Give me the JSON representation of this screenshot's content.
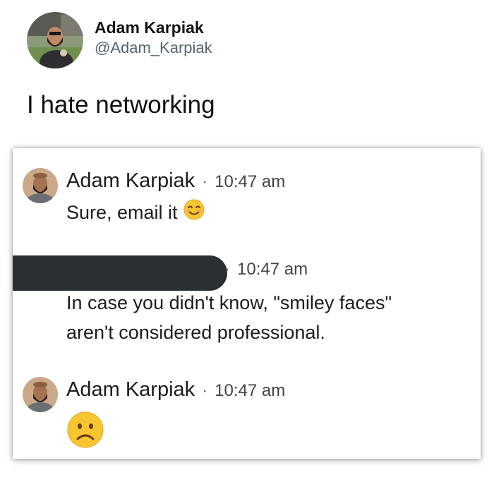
{
  "tweet": {
    "author_name": "Adam Karpiak",
    "author_handle": "@Adam_Karpiak",
    "text": "I hate networking"
  },
  "messages": [
    {
      "sender": "Adam Karpiak",
      "time": "10:47 am",
      "text": "Sure, email it",
      "emoji": "smiling-face-icon"
    },
    {
      "sender": "",
      "sender_redacted": true,
      "time": "10:47 am",
      "text_line1": "In case you didn't know, \"smiley faces\"",
      "text_line2": "aren't considered professional."
    },
    {
      "sender": "Adam Karpiak",
      "time": "10:47 am",
      "emoji": "frowning-face-icon"
    }
  ],
  "separator": "·"
}
